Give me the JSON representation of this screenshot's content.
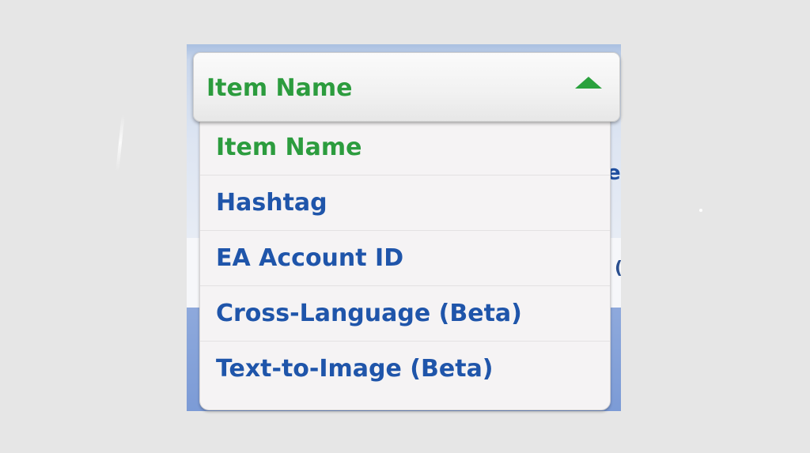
{
  "dropdown": {
    "selected_label": "Item Name",
    "expanded": true,
    "items": [
      {
        "label": "Item Name",
        "selected": true
      },
      {
        "label": "Hashtag",
        "selected": false
      },
      {
        "label": "EA Account ID",
        "selected": false
      },
      {
        "label": "Cross-Language (Beta)",
        "selected": false
      },
      {
        "label": "Text-to-Image (Beta)",
        "selected": false
      }
    ],
    "arrow_icon": "triangle-up-icon"
  },
  "background": {
    "peek_text": "e"
  },
  "colors": {
    "selected_text": "#2c9c3e",
    "option_text": "#1f55aa",
    "menu_background": "#f5f3f4",
    "arrow": "#2aa13d",
    "page_background": "#e6e6e6"
  }
}
